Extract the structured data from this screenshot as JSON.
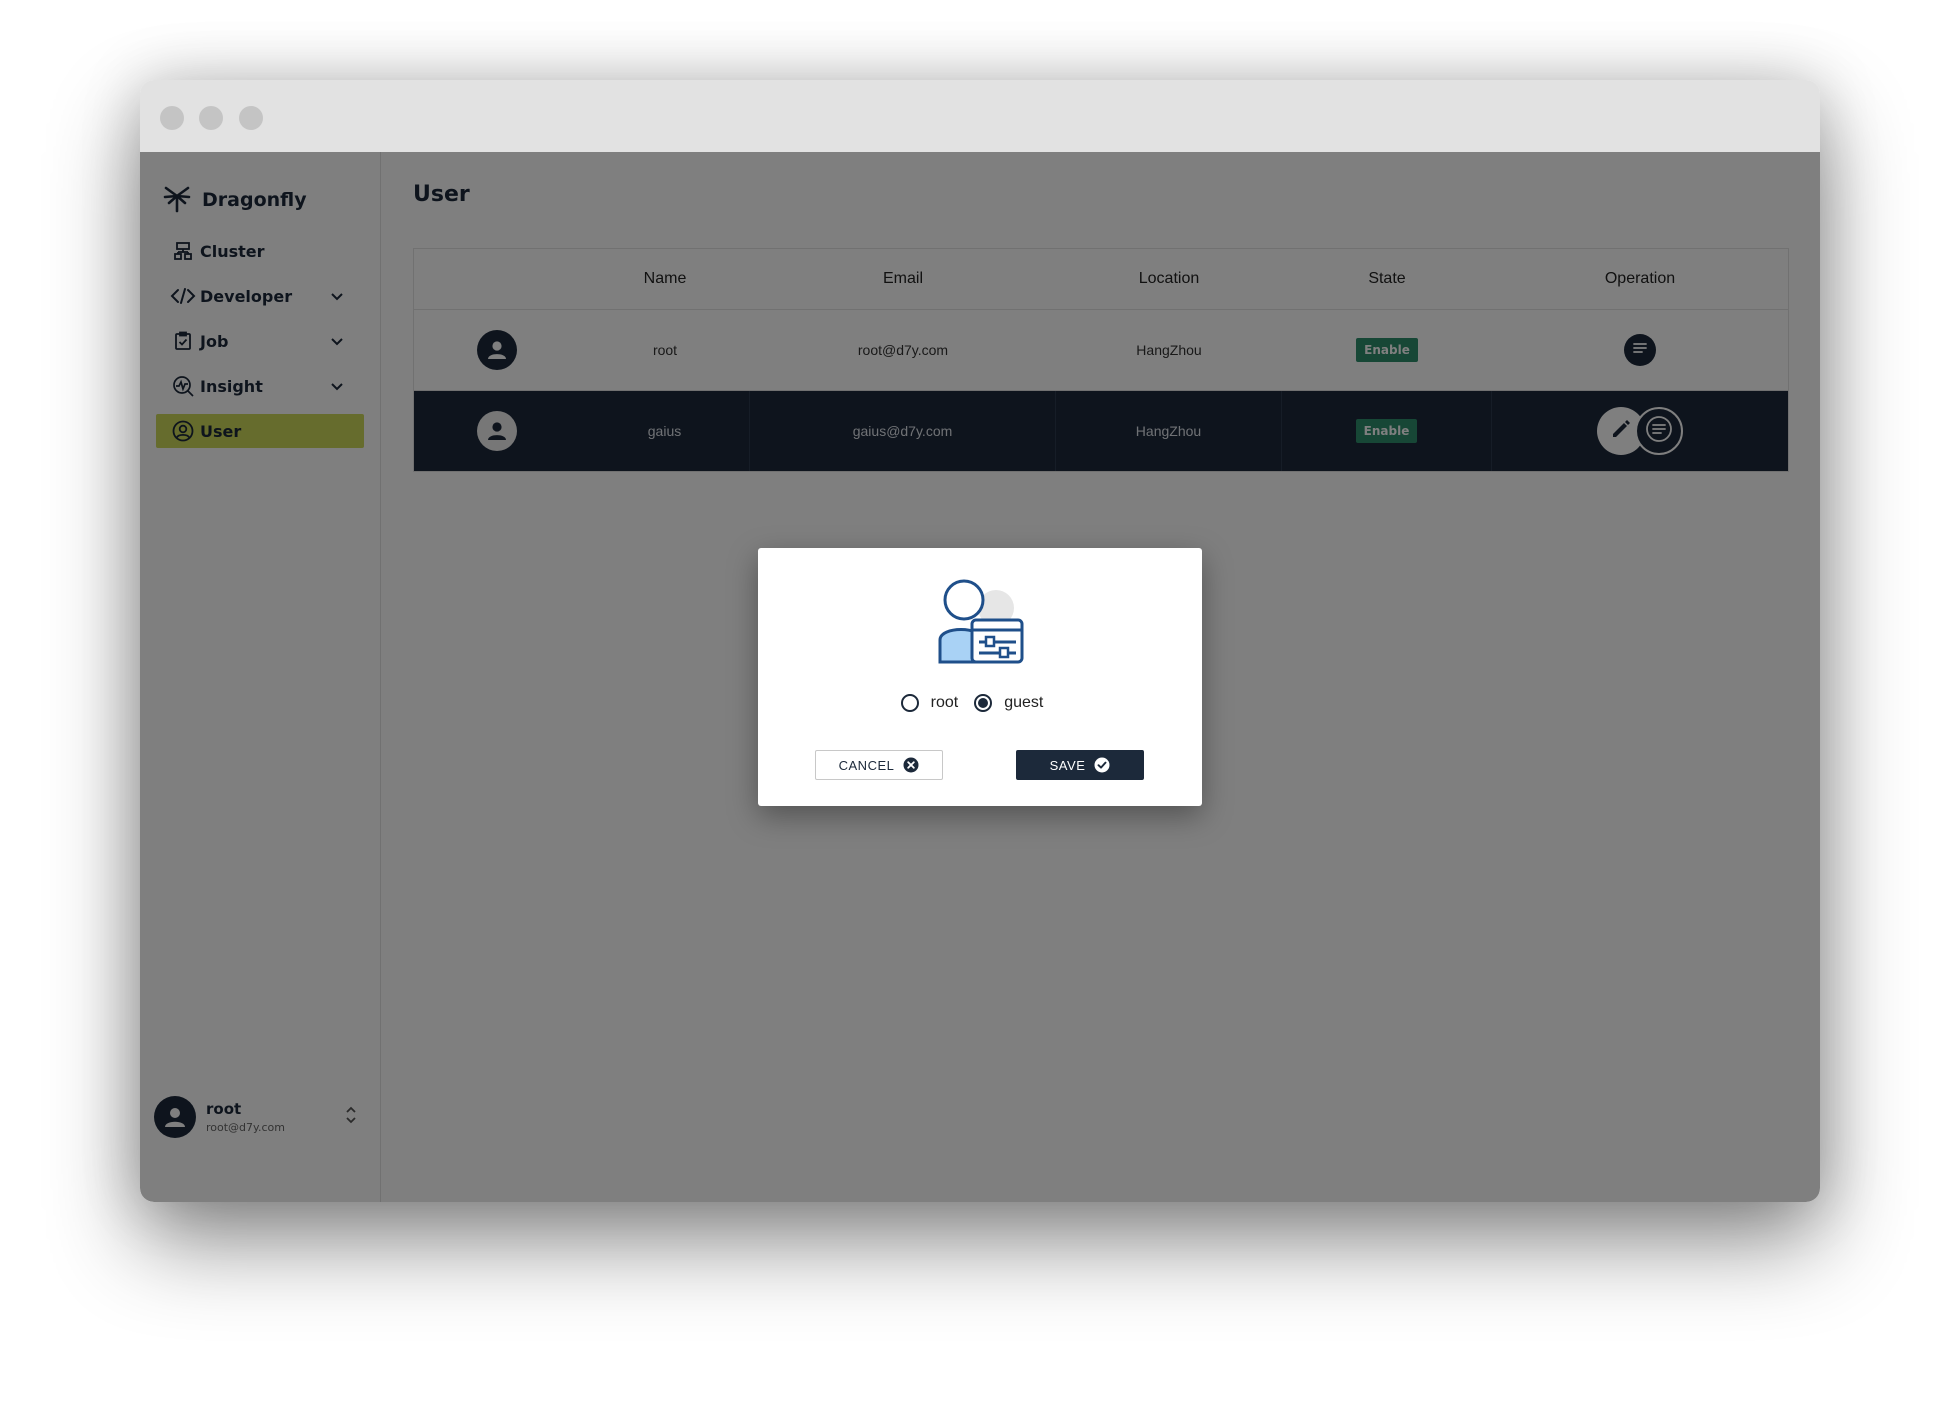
{
  "app": {
    "name": "Dragonfly"
  },
  "sidebar": {
    "items": [
      {
        "label": "Cluster",
        "icon": "cluster-icon",
        "expandable": false,
        "active": false
      },
      {
        "label": "Developer",
        "icon": "code-icon",
        "expandable": true,
        "active": false
      },
      {
        "label": "Job",
        "icon": "clipboard-check-icon",
        "expandable": true,
        "active": false
      },
      {
        "label": "Insight",
        "icon": "insight-icon",
        "expandable": true,
        "active": false
      },
      {
        "label": "User",
        "icon": "user-circle-icon",
        "expandable": false,
        "active": true
      }
    ],
    "profile": {
      "name": "root",
      "email": "root@d7y.com"
    }
  },
  "main": {
    "title": "User",
    "table": {
      "headers": [
        "",
        "Name",
        "Email",
        "Location",
        "State",
        "Operation"
      ],
      "rows": [
        {
          "name": "root",
          "email": "root@d7y.com",
          "location": "HangZhou",
          "state": "Enable"
        },
        {
          "name": "gaius",
          "email": "gaius@d7y.com",
          "location": "HangZhou",
          "state": "Enable"
        }
      ]
    }
  },
  "dialog": {
    "options": [
      {
        "label": "root",
        "selected": false
      },
      {
        "label": "guest",
        "selected": true
      }
    ],
    "cancel_label": "CANCEL",
    "save_label": "SAVE"
  },
  "colors": {
    "primary": "#1c293a",
    "active_nav": "#ccd85a",
    "badge": "#2e8f6d",
    "overlay": "rgba(0,0,0,0.5)"
  }
}
